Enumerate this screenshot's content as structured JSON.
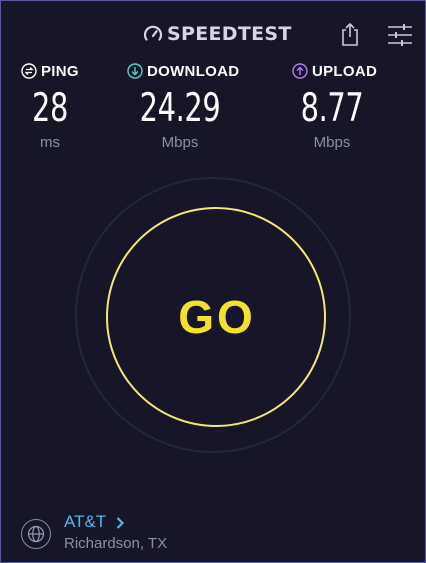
{
  "header": {
    "logo_text": "SPEEDTEST",
    "logo_icon": "speedometer-icon",
    "share_icon": "share-icon",
    "settings_icon": "sliders-icon"
  },
  "metrics": {
    "ping": {
      "label": "PING",
      "value": "28",
      "unit": "ms",
      "icon": "ping-icon",
      "icon_color": "#ffffff"
    },
    "download": {
      "label": "DOWNLOAD",
      "value": "24.29",
      "unit": "Mbps",
      "icon": "download-arrow-icon",
      "icon_color": "#5ad1d2"
    },
    "upload": {
      "label": "UPLOAD",
      "value": "8.77",
      "unit": "Mbps",
      "icon": "upload-arrow-icon",
      "icon_color": "#b77cf4"
    }
  },
  "go_button": {
    "label": "GO"
  },
  "provider": {
    "name": "AT&T",
    "location": "Richardson, TX",
    "icon": "globe-icon"
  },
  "colors": {
    "background": "#161628",
    "accent_yellow": "#f4e22a",
    "ring_yellow": "#f4e872",
    "link_blue": "#4fb7e9",
    "muted_text": "#8e8ea6"
  }
}
